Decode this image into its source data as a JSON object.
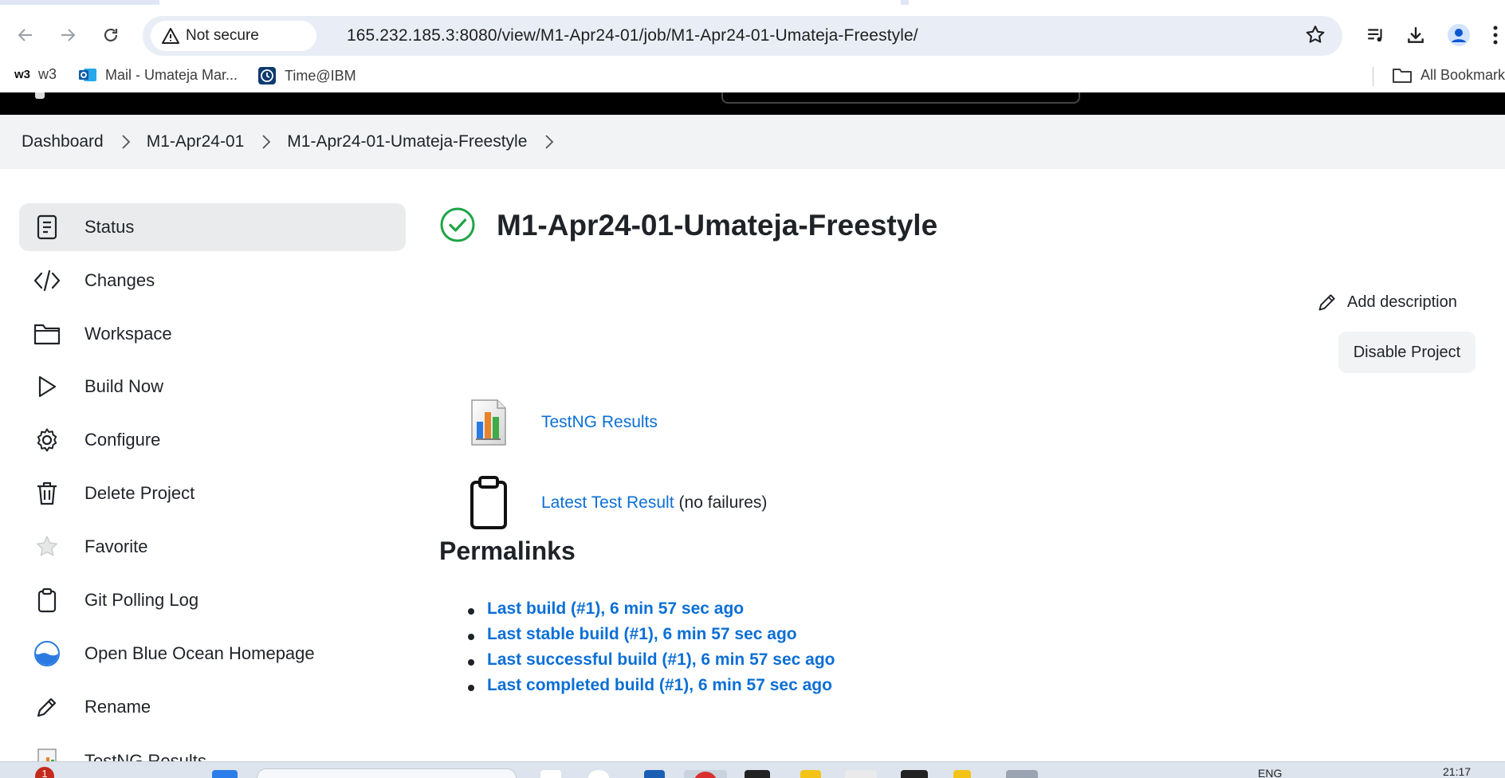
{
  "browser": {
    "security_label": "Not secure",
    "url": "165.232.185.3:8080/view/M1-Apr24-01/job/M1-Apr24-01-Umateja-Freestyle/",
    "bookmarks": [
      {
        "label": "w3",
        "icon": "w3-icon",
        "icon_text": "w3"
      },
      {
        "label": "Mail - Umateja Mar...",
        "icon": "outlook-icon"
      },
      {
        "label": "Time@IBM",
        "icon": "clock-icon"
      }
    ],
    "all_bookmarks_label": "All Bookmarks"
  },
  "breadcrumbs": [
    "Dashboard",
    "M1-Apr24-01",
    "M1-Apr24-01-Umateja-Freestyle"
  ],
  "sidebar": {
    "items": [
      {
        "label": "Status",
        "icon": "status-icon",
        "active": true
      },
      {
        "label": "Changes",
        "icon": "code-icon"
      },
      {
        "label": "Workspace",
        "icon": "folder-icon"
      },
      {
        "label": "Build Now",
        "icon": "play-icon"
      },
      {
        "label": "Configure",
        "icon": "gear-icon"
      },
      {
        "label": "Delete Project",
        "icon": "trash-icon"
      },
      {
        "label": "Favorite",
        "icon": "star-icon"
      },
      {
        "label": "Git Polling Log",
        "icon": "clipboard-icon"
      },
      {
        "label": "Open Blue Ocean Homepage",
        "icon": "blue-ocean-icon"
      },
      {
        "label": "Rename",
        "icon": "pencil-icon"
      },
      {
        "label": "TestNG Results",
        "icon": "report-icon"
      }
    ]
  },
  "job": {
    "title": "M1-Apr24-01-Umateja-Freestyle",
    "status": "success",
    "status_color": "#1ea446"
  },
  "actions": {
    "add_description": "Add description",
    "disable_project": "Disable Project"
  },
  "reports": {
    "testng_label": "TestNG Results",
    "latest_test_label": "Latest Test Result",
    "latest_test_note": "(no failures)"
  },
  "permalinks": {
    "heading": "Permalinks",
    "items": [
      "Last build (#1), 6 min 57 sec ago",
      "Last stable build (#1), 6 min 57 sec ago",
      "Last successful build (#1), 6 min 57 sec ago",
      "Last completed build (#1), 6 min 57 sec ago"
    ]
  },
  "taskbar": {
    "notification_count": "1",
    "language": "ENG",
    "time": "21:17"
  },
  "colors": {
    "link": "#0b6fd6",
    "header": "#000000",
    "breadcrumb_bg": "#f2f3f5"
  }
}
